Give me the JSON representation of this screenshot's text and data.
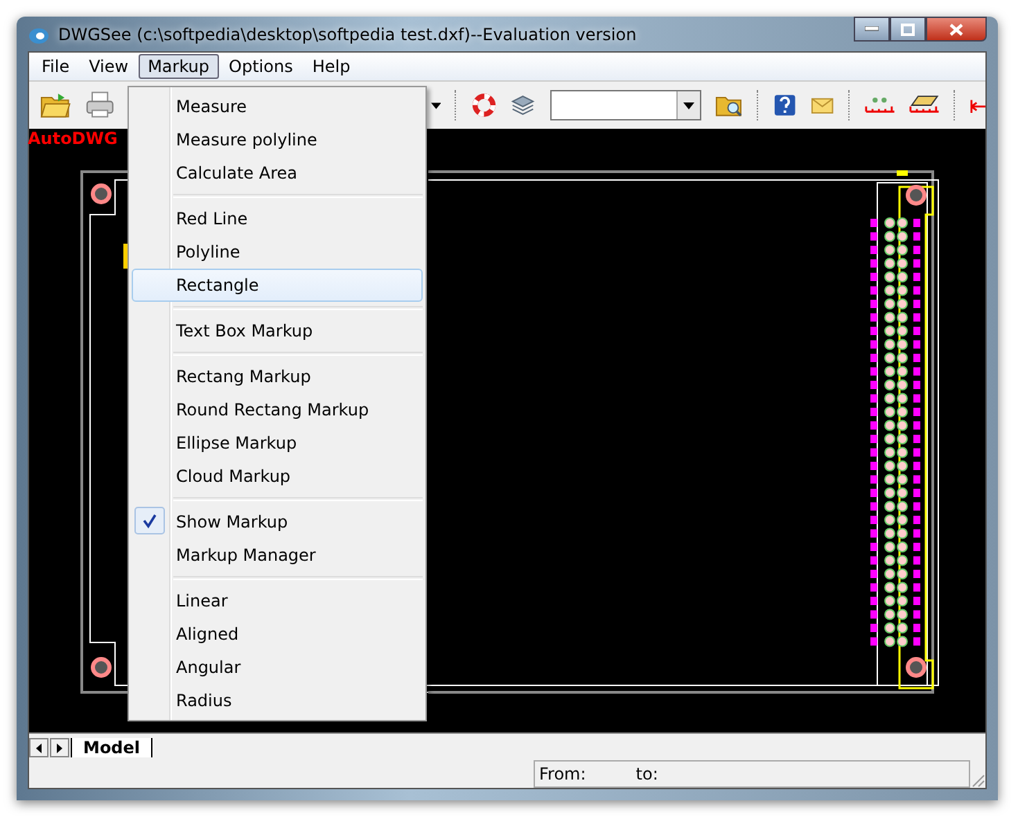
{
  "window": {
    "title": "DWGSee (c:\\softpedia\\desktop\\softpedia test.dxf)--Evaluation version"
  },
  "menu_bar": [
    {
      "label": "File",
      "selected": false
    },
    {
      "label": "View",
      "selected": false
    },
    {
      "label": "Markup",
      "selected": true
    },
    {
      "label": "Options",
      "selected": false
    },
    {
      "label": "Help",
      "selected": false
    }
  ],
  "markup_menu": {
    "groups": [
      [
        {
          "label": "Measure",
          "selected": false,
          "checked": false
        },
        {
          "label": "Measure polyline",
          "selected": false,
          "checked": false
        },
        {
          "label": "Calculate Area",
          "selected": false,
          "checked": false
        }
      ],
      [
        {
          "label": "Red Line",
          "selected": false,
          "checked": false
        },
        {
          "label": "Polyline",
          "selected": false,
          "checked": false
        },
        {
          "label": "Rectangle",
          "selected": true,
          "checked": false
        }
      ],
      [
        {
          "label": "Text Box Markup",
          "selected": false,
          "checked": false
        }
      ],
      [
        {
          "label": "Rectang Markup",
          "selected": false,
          "checked": false
        },
        {
          "label": "Round Rectang Markup",
          "selected": false,
          "checked": false
        },
        {
          "label": "Ellipse Markup",
          "selected": false,
          "checked": false
        },
        {
          "label": "Cloud Markup",
          "selected": false,
          "checked": false
        }
      ],
      [
        {
          "label": "Show Markup",
          "selected": false,
          "checked": true
        },
        {
          "label": "Markup Manager",
          "selected": false,
          "checked": false
        }
      ],
      [
        {
          "label": "Linear",
          "selected": false,
          "checked": false
        },
        {
          "label": "Aligned",
          "selected": false,
          "checked": false
        },
        {
          "label": "Angular",
          "selected": false,
          "checked": false
        },
        {
          "label": "Radius",
          "selected": false,
          "checked": false
        }
      ]
    ]
  },
  "canvas": {
    "brand_text": "AutoDWG"
  },
  "layout_tabs": [
    {
      "label": "Model",
      "selected": true
    }
  ],
  "status_bar": {
    "from_label": "From:",
    "to_label": "to:"
  }
}
